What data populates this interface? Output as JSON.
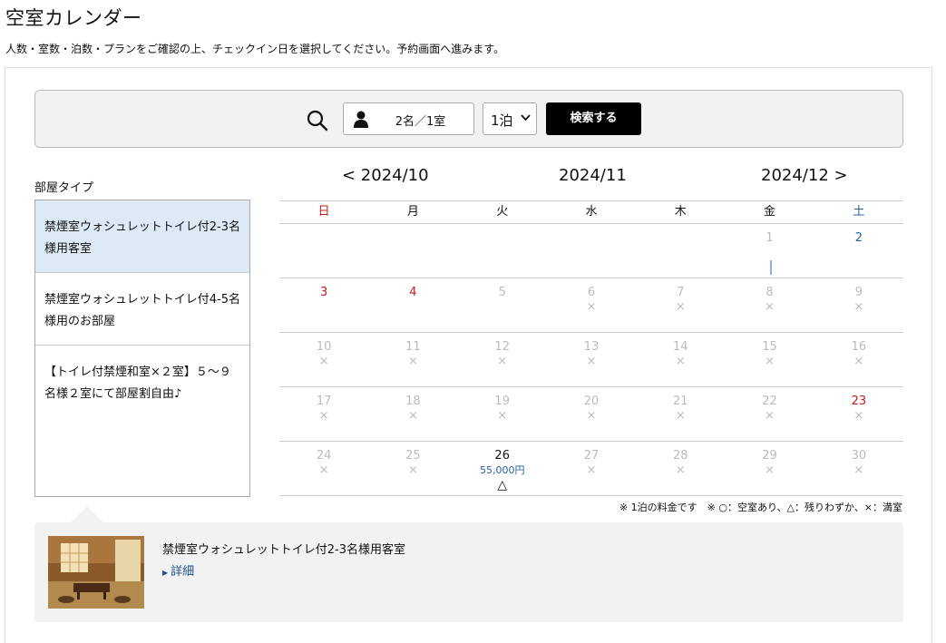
{
  "page": {
    "title": "空室カレンダー",
    "intro": "人数・室数・泊数・プランをご確認の上、チェックイン日を選択してください。予約画面へ進みます。"
  },
  "search": {
    "guests": "2名／1室",
    "nights": "1泊",
    "button": "検索する"
  },
  "room_types": {
    "label": "部屋タイプ",
    "items": [
      {
        "label": "禁煙室ウォシュレットトイレ付2-3名様用客室",
        "active": true
      },
      {
        "label": "禁煙室ウォシュレットトイレ付4-5名様用のお部屋",
        "active": false
      },
      {
        "label": "【トイレ付禁煙和室×２室】５～９名様２室にて部屋割自由♪",
        "active": false
      }
    ]
  },
  "calendar": {
    "prev_month": "< 2024/10",
    "current_month": "2024/11",
    "next_month": "2024/12 >",
    "weekdays": [
      "日",
      "月",
      "火",
      "水",
      "木",
      "金",
      "土"
    ],
    "weeks": [
      [
        {
          "day": "",
          "mark": ""
        },
        {
          "day": "",
          "mark": ""
        },
        {
          "day": "",
          "mark": ""
        },
        {
          "day": "",
          "mark": ""
        },
        {
          "day": "",
          "mark": ""
        },
        {
          "day": "1",
          "mark": ""
        },
        {
          "day": "2",
          "mark": "",
          "style": "sat"
        }
      ],
      [
        {
          "day": "3",
          "mark": "",
          "style": "sun"
        },
        {
          "day": "4",
          "mark": "",
          "style": "sun"
        },
        {
          "day": "5",
          "mark": ""
        },
        {
          "day": "6",
          "mark": "×"
        },
        {
          "day": "7",
          "mark": "×"
        },
        {
          "day": "8",
          "mark": "×"
        },
        {
          "day": "9",
          "mark": "×"
        }
      ],
      [
        {
          "day": "10",
          "mark": "×"
        },
        {
          "day": "11",
          "mark": "×"
        },
        {
          "day": "12",
          "mark": "×"
        },
        {
          "day": "13",
          "mark": "×"
        },
        {
          "day": "14",
          "mark": "×"
        },
        {
          "day": "15",
          "mark": "×"
        },
        {
          "day": "16",
          "mark": "×"
        }
      ],
      [
        {
          "day": "17",
          "mark": "×"
        },
        {
          "day": "18",
          "mark": "×"
        },
        {
          "day": "19",
          "mark": "×"
        },
        {
          "day": "20",
          "mark": "×"
        },
        {
          "day": "21",
          "mark": "×"
        },
        {
          "day": "22",
          "mark": "×"
        },
        {
          "day": "23",
          "mark": "×",
          "style": "sun"
        }
      ],
      [
        {
          "day": "24",
          "mark": "×"
        },
        {
          "day": "25",
          "mark": "×"
        },
        {
          "day": "26",
          "mark": "△",
          "price": "55,000円",
          "style": "avail"
        },
        {
          "day": "27",
          "mark": "×"
        },
        {
          "day": "28",
          "mark": "×"
        },
        {
          "day": "29",
          "mark": "×"
        },
        {
          "day": "30",
          "mark": "×"
        }
      ]
    ],
    "legend": "※ 1泊の料金です　※ ○：空室あり、△：残りわずか、×：満室"
  },
  "detail": {
    "room_name": "禁煙室ウォシュレットトイレ付2-3名様用客室",
    "link": "詳細"
  },
  "colors": {
    "sunday_holiday": "#c8181e",
    "saturday": "#2a5fa5",
    "price": "#2a5fa5",
    "active_room": "#dbeaf5",
    "button_bg": "#000000"
  },
  "icons": [
    "search-icon",
    "person-icon",
    "chevron-down-icon",
    "room-photo"
  ]
}
